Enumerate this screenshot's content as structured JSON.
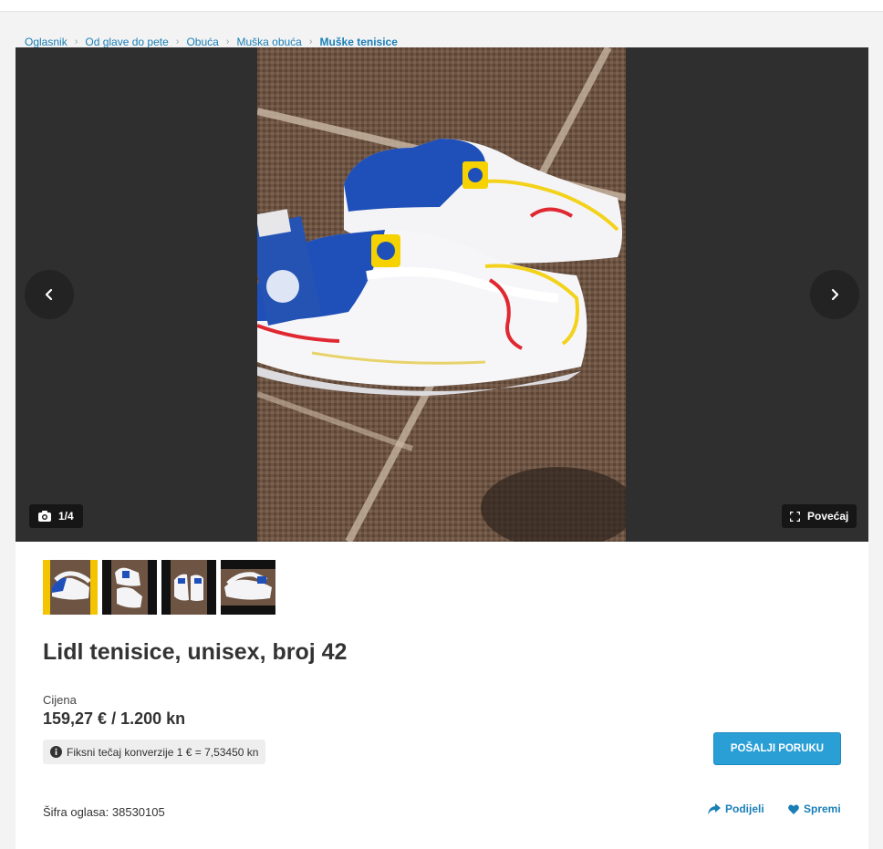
{
  "breadcrumb": {
    "items": [
      "Oglasnik",
      "Od glave do pete",
      "Obuća",
      "Muška obuća"
    ],
    "current": "Muške tenisice"
  },
  "gallery": {
    "counter": "1/4",
    "zoom_label": "Povećaj",
    "icons": [
      "chevron-left-icon",
      "chevron-right-icon",
      "camera-icon",
      "expand-icon"
    ]
  },
  "listing": {
    "title": "Lidl tenisice, unisex, broj 42",
    "price_label": "Cijena",
    "price": "159,27 € / 1.200 kn",
    "rate_note": "Fiksni tečaj konverzije 1 € = 7,53450 kn",
    "send_button": "POŠALJI PORUKU",
    "ad_code": "Šifra oglasa: 38530105",
    "share_label": "Podijeli",
    "save_label": "Spremi"
  },
  "colors": {
    "link": "#1a7fb7",
    "button": "#2a9fd6",
    "active_thumb_border": "#f5c400"
  }
}
